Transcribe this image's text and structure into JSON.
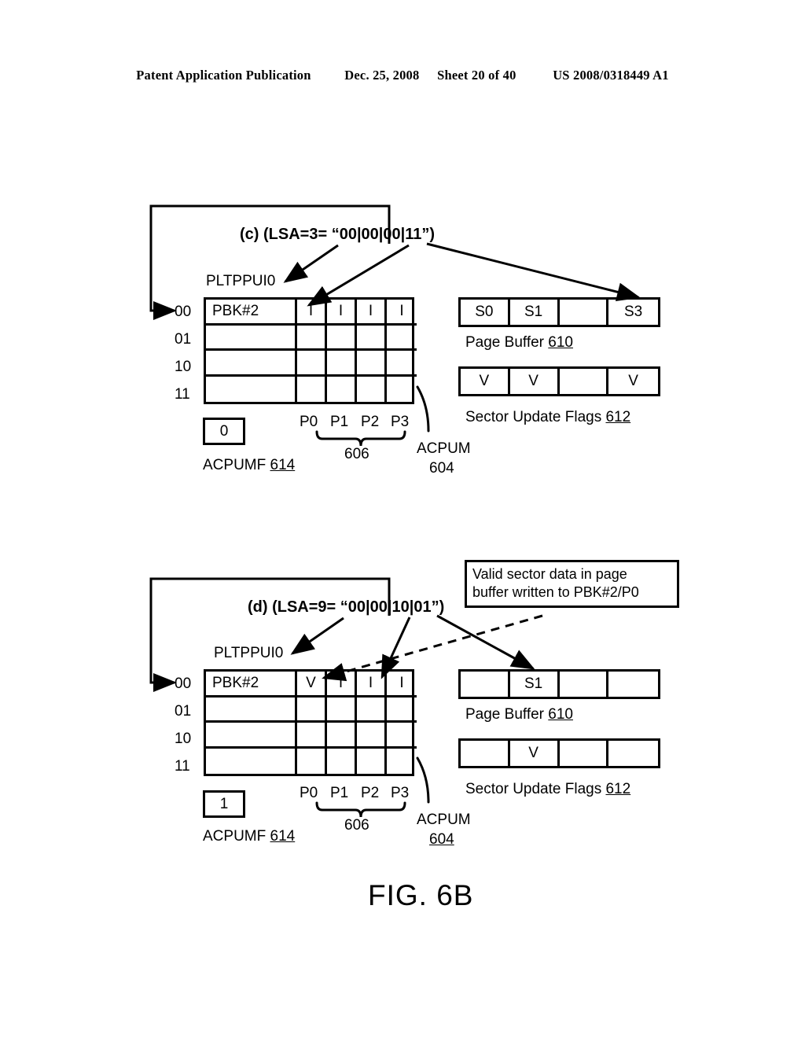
{
  "header": {
    "publication": "Patent Application Publication",
    "date": "Dec. 25, 2008",
    "sheet": "Sheet 20 of 40",
    "patent_number": "US 2008/0318449 A1"
  },
  "figure": {
    "caption": "FIG. 6B"
  },
  "panel_c": {
    "title": "(c) (LSA=3= “00|00|00|11”)",
    "pltppui_label": "PLTPPUI0",
    "row_labels": [
      "00",
      "01",
      "10",
      "11"
    ],
    "table": {
      "rows": [
        [
          "PBK#2",
          "I",
          "I",
          "I",
          "I"
        ],
        [
          "",
          "",
          "",
          "",
          ""
        ],
        [
          "",
          "",
          "",
          "",
          ""
        ],
        [
          "",
          "",
          "",
          "",
          ""
        ]
      ]
    },
    "page_labels": [
      "P0",
      "P1",
      "P2",
      "P3"
    ],
    "brace_ref": "606",
    "acpum_label": "ACPUM",
    "acpum_ref": "604",
    "acpumf_value": "0",
    "acpumf_label": "ACPUMF",
    "acpumf_ref": "614",
    "page_buffer": {
      "cells": [
        "S0",
        "S1",
        "",
        "S3"
      ],
      "label": "Page Buffer",
      "ref": "610"
    },
    "sector_update_flags": {
      "cells": [
        "V",
        "V",
        "",
        "V"
      ],
      "label": "Sector Update Flags",
      "ref": "612"
    }
  },
  "panel_d": {
    "title": "(d) (LSA=9= “00|00|10|01”)",
    "pltppui_label": "PLTPPUI0",
    "row_labels": [
      "00",
      "01",
      "10",
      "11"
    ],
    "table": {
      "rows": [
        [
          "PBK#2",
          "V",
          "I",
          "I",
          "I"
        ],
        [
          "",
          "",
          "",
          "",
          ""
        ],
        [
          "",
          "",
          "",
          "",
          ""
        ],
        [
          "",
          "",
          "",
          "",
          ""
        ]
      ]
    },
    "page_labels": [
      "P0",
      "P1",
      "P2",
      "P3"
    ],
    "brace_ref": "606",
    "acpum_label": "ACPUM",
    "acpum_ref": "604",
    "acpumf_value": "1",
    "acpumf_label": "ACPUMF",
    "acpumf_ref": "614",
    "page_buffer": {
      "cells": [
        "",
        "S1",
        "",
        ""
      ],
      "label": "Page Buffer",
      "ref": "610"
    },
    "sector_update_flags": {
      "cells": [
        "",
        "V",
        "",
        ""
      ],
      "label": "Sector Update Flags",
      "ref": "612"
    },
    "callout": {
      "line1": "Valid sector data in page",
      "line2": "buffer written to PBK#2/P0"
    }
  }
}
